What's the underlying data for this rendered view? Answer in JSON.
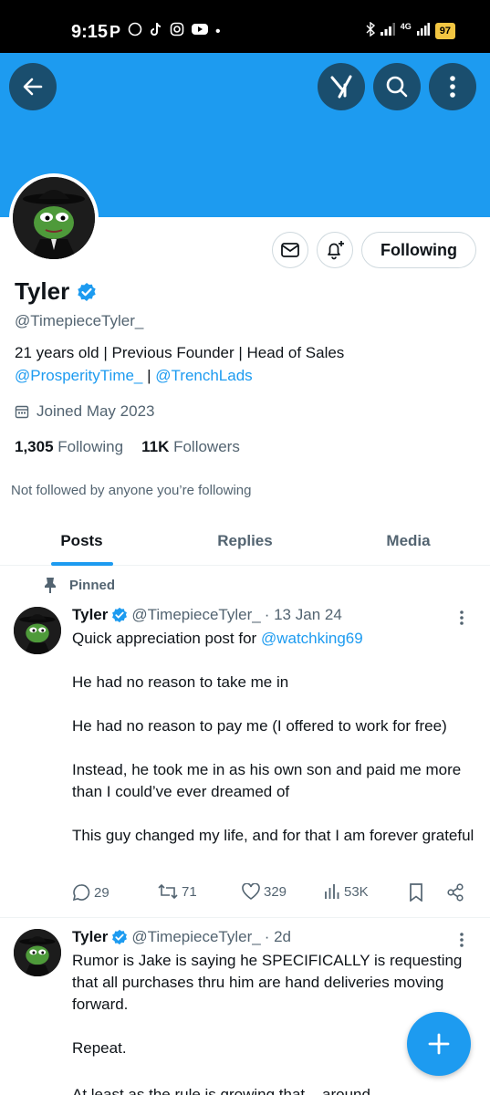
{
  "status_bar": {
    "time": "9:15",
    "notification_icons": [
      "P",
      "whatsapp-icon",
      "tiktok-icon",
      "instagram-icon",
      "youtube-icon",
      "•"
    ],
    "network_label": "4G",
    "battery": "97"
  },
  "colors": {
    "accent": "#1d9bf0",
    "banner": "#1d9bf0",
    "text": "#0f1419",
    "muted": "#536471"
  },
  "profile": {
    "name": "Tyler",
    "handle": "@TimepieceTyler_",
    "bio_line1": "21 years old | Previous Founder | Head of Sales",
    "bio_link1": "@ProsperityTime_",
    "bio_sep": " | ",
    "bio_link2": "@TrenchLads",
    "joined": "Joined May 2023",
    "following_count": "1,305",
    "following_label": "Following",
    "followers_count": "11K",
    "followers_label": "Followers",
    "not_followed": "Not followed by anyone you’re following",
    "follow_button": "Following"
  },
  "tabs": [
    {
      "label": "Posts",
      "active": true
    },
    {
      "label": "Replies",
      "active": false
    },
    {
      "label": "Media",
      "active": false
    }
  ],
  "pinned_label": "Pinned",
  "tweets": [
    {
      "name": "Tyler",
      "handle": "@TimepieceTyler_",
      "date": "· 13 Jan 24",
      "intro": "Quick appreciation post for ",
      "mention": "@watchking69",
      "paragraphs": [
        "He had no reason to take me in",
        "He had no reason to pay me (I offered to work for free)",
        "Instead, he took me in as his own son and paid me more than I could’ve ever dreamed of",
        "This guy changed my life, and for that I am forever grateful"
      ],
      "replies": "29",
      "reposts": "71",
      "likes": "329",
      "views": "53K"
    },
    {
      "name": "Tyler",
      "handle": "@TimepieceTyler_",
      "date": "· 2d",
      "paragraphs": [
        "Rumor is Jake is saying he SPECIFICALLY is requesting that all purchases thru him are hand deliveries moving forward.",
        "Repeat.",
        "At least as the rule is growing that... around"
      ]
    }
  ]
}
